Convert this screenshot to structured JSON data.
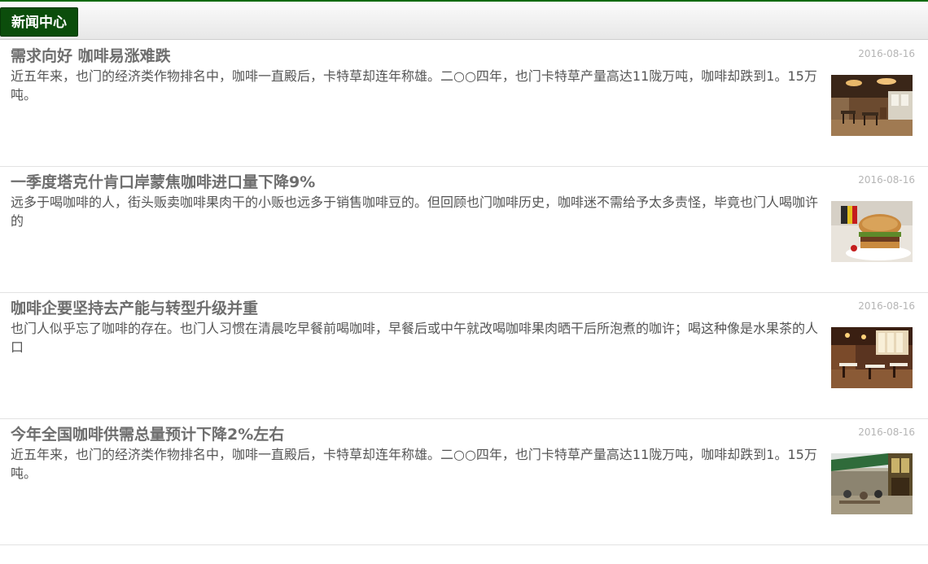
{
  "header": {
    "tab_label": "新闻中心"
  },
  "news": [
    {
      "title": "需求向好 咖啡易涨难跌",
      "date": "2016-08-16",
      "desc": "近五年来，也门的经济类作物排名中，咖啡一直殿后，卡特草却连年称雄。二○○四年，也门卡特草产量高达11陇万吨，咖啡却跌到1。15万吨。",
      "thumb": "cafe-interior-image"
    },
    {
      "title": "一季度塔克什肯口岸蒙焦咖啡进口量下降9%",
      "date": "2016-08-16",
      "desc": "远多于喝咖啡的人，街头贩卖咖啡果肉干的小贩也远多于销售咖啡豆的。但回顾也门咖啡历史，咖啡迷不需给予太多责怪，毕竟也门人喝咖许的",
      "thumb": "burger-image"
    },
    {
      "title": "咖啡企要坚持去产能与转型升级并重",
      "date": "2016-08-16",
      "desc": "也门人似乎忘了咖啡的存在。也门人习惯在清晨吃早餐前喝咖啡，早餐后或中午就改喝咖啡果肉晒干后所泡煮的咖许；喝这种像是水果茶的人口",
      "thumb": "restaurant-interior-image"
    },
    {
      "title": "今年全国咖啡供需总量预计下降2%左右",
      "date": "2016-08-16",
      "desc": "近五年来，也门的经济类作物排名中，咖啡一直殿后，卡特草却连年称雄。二○○四年，也门卡特草产量高达11陇万吨，咖啡却跌到1。15万吨。",
      "thumb": "street-cafe-image"
    }
  ]
}
